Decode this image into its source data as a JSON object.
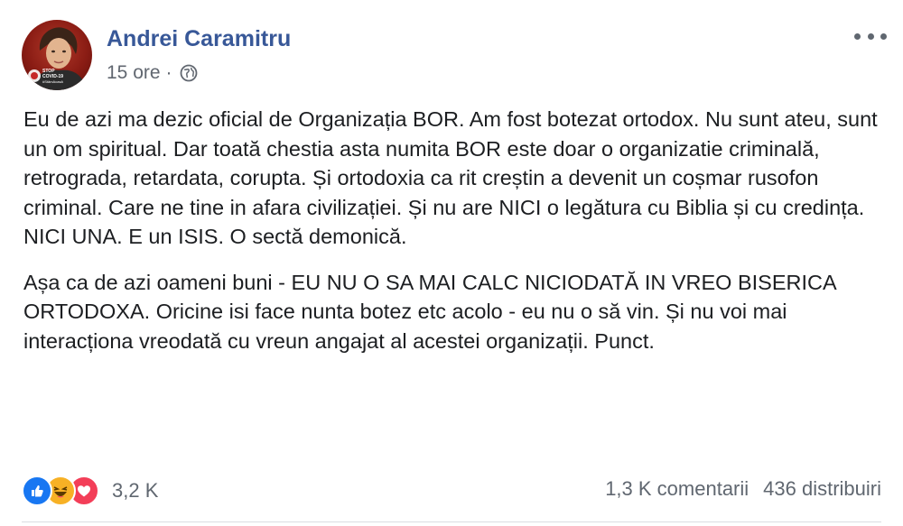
{
  "post": {
    "author": "Andrei Caramitru",
    "time": "15 ore",
    "separator": "·",
    "visibility_icon": "globe-icon",
    "avatar_badge": {
      "line1": "STOP",
      "line2": "COVID-19",
      "line3": "#StămAcasă"
    },
    "paragraphs": [
      "Eu de azi ma dezic oficial de Organizația BOR. Am fost botezat ortodox. Nu sunt ateu, sunt un om spiritual. Dar toată chestia asta numita BOR este doar o organizatie criminală, retrograda, retardata, corupta. Și ortodoxia ca rit creștin a devenit un coșmar rusofon criminal. Care ne tine in afara civilizației. Și nu are NICI o legătura cu Biblia și cu credința. NICI UNA. E un ISIS. O sectă demonică.",
      "Așa ca de azi oameni buni - EU NU O SA MAI CALC NICIODATĂ IN VREO BISERICA ORTODOXA. Oricine isi face nunta botez etc acolo - eu nu o să vin. Și nu voi mai interacționa vreodată cu vreun angajat al acestei organizații. Punct."
    ]
  },
  "reactions": {
    "icons": [
      "like-icon",
      "haha-icon",
      "love-icon"
    ],
    "count": "3,2 K"
  },
  "stats": {
    "comments": "1,3 K comentarii",
    "shares": "436 distribuiri"
  },
  "colors": {
    "author": "#385898",
    "meta": "#616770",
    "like": "#1877f2",
    "haha": "#f7b125",
    "love": "#f33e58"
  }
}
